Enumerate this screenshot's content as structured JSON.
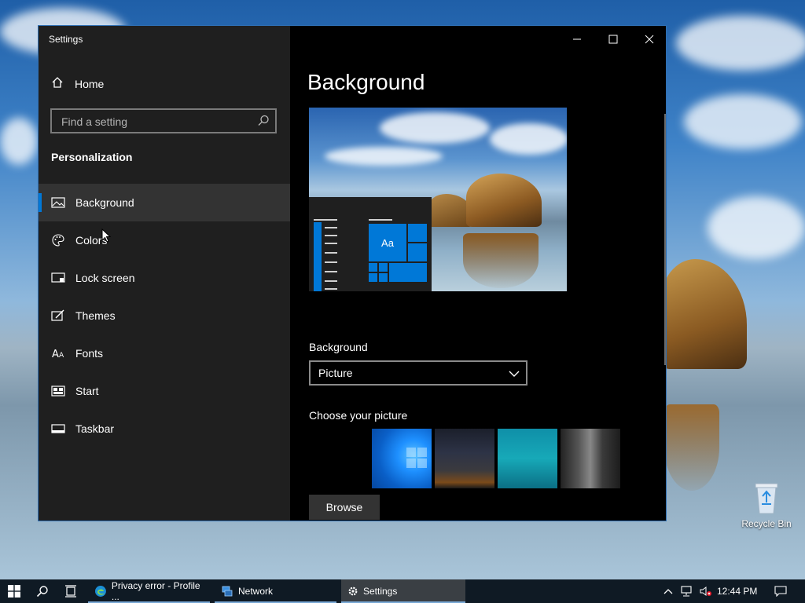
{
  "window": {
    "title": "Settings",
    "controls": {
      "minimize": "–",
      "maximize": "☐",
      "close": "✕"
    }
  },
  "sidebar": {
    "home_label": "Home",
    "search_placeholder": "Find a setting",
    "section_title": "Personalization",
    "items": [
      {
        "label": "Background",
        "icon": "picture-icon",
        "active": true
      },
      {
        "label": "Colors",
        "icon": "palette-icon",
        "active": false
      },
      {
        "label": "Lock screen",
        "icon": "lock-screen-icon",
        "active": false
      },
      {
        "label": "Themes",
        "icon": "themes-icon",
        "active": false
      },
      {
        "label": "Fonts",
        "icon": "fonts-icon",
        "active": false
      },
      {
        "label": "Start",
        "icon": "start-icon",
        "active": false
      },
      {
        "label": "Taskbar",
        "icon": "taskbar-icon",
        "active": false
      }
    ]
  },
  "content": {
    "page_title": "Background",
    "preview_tile_text": "Aa",
    "background_label": "Background",
    "background_value": "Picture",
    "choose_label": "Choose your picture",
    "browse_label": "Browse"
  },
  "desktop": {
    "recycle_bin_label": "Recycle Bin"
  },
  "taskbar": {
    "apps": [
      {
        "label": "Privacy error - Profile ...",
        "icon": "edge-icon"
      },
      {
        "label": "Network",
        "icon": "network-icon"
      },
      {
        "label": "Settings",
        "icon": "gear-icon"
      }
    ],
    "clock": "12:44 PM"
  },
  "colors": {
    "accent": "#0078d7",
    "sidebar_bg": "#1f1f1f",
    "content_bg": "#000000",
    "taskbar_bg": "#0f1a24"
  }
}
